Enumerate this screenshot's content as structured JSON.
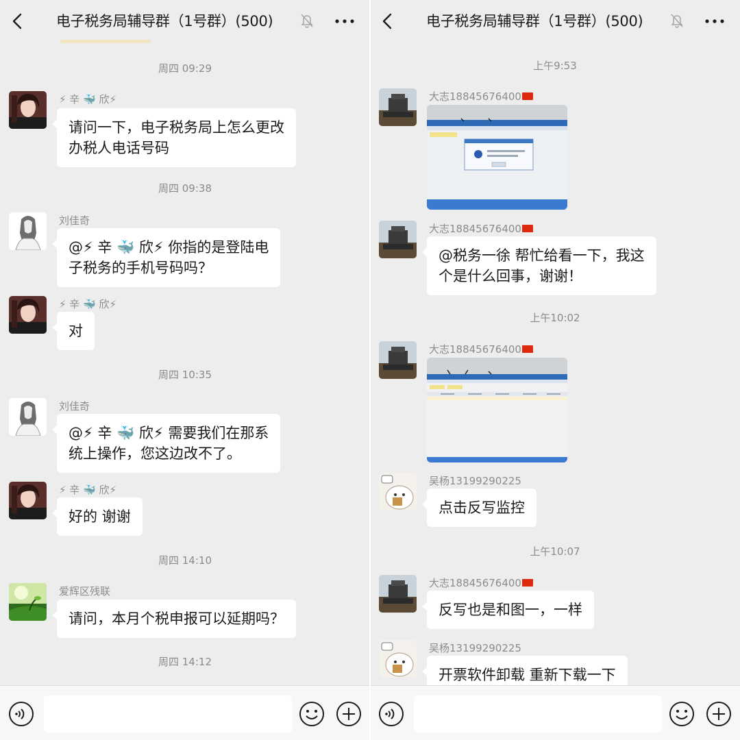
{
  "left": {
    "header": {
      "title": "电子税务局辅导群（1号群）(500)"
    },
    "messages": [
      {
        "time": "周四 09:29"
      },
      {
        "sender": "⚡ 辛 🐳 欣⚡",
        "lines": [
          "请问一下，电子税务局上怎么更改",
          "办税人电话号码"
        ]
      },
      {
        "time": "周四 09:38"
      },
      {
        "sender": "刘佳奇",
        "lines": [
          "@⚡ 辛 🐳 欣⚡ 你指的是登陆电",
          "子税务的手机号码吗？"
        ]
      },
      {
        "sender": "⚡ 辛 🐳 欣⚡",
        "lines": [
          "对"
        ]
      },
      {
        "time": "周四 10:35"
      },
      {
        "sender": "刘佳奇",
        "lines": [
          "@⚡ 辛 🐳 欣⚡ 需要我们在那系",
          "统上操作，您这边改不了。"
        ]
      },
      {
        "sender": "⚡ 辛 🐳 欣⚡",
        "lines": [
          "好的  谢谢"
        ]
      },
      {
        "time": "周四 14:10"
      },
      {
        "sender": "爱辉区残联",
        "lines": [
          "请问，本月个税申报可以延期吗？"
        ]
      },
      {
        "time": "周四 14:12"
      }
    ],
    "input": {
      "placeholder": ""
    }
  },
  "right": {
    "header": {
      "title": "电子税务局辅导群（1号群）(500)"
    },
    "messages": [
      {
        "time": "上午9:53"
      },
      {
        "sender": "大志18845676400",
        "image": "screenshot-dialog"
      },
      {
        "sender": "大志18845676400",
        "lines": [
          "@税务一徐  帮忙给看一下，我这",
          "个是什么回事，谢谢！"
        ]
      },
      {
        "time": "上午10:02"
      },
      {
        "sender": "大志18845676400",
        "image": "screenshot-table"
      },
      {
        "sender": "吴杨13199290225",
        "lines": [
          "点击反写监控"
        ]
      },
      {
        "time": "上午10:07"
      },
      {
        "sender": "大志18845676400",
        "lines": [
          "反写也是和图一，一样"
        ]
      },
      {
        "sender": "吴杨13199290225",
        "lines": [
          "开票软件卸载 重新下载一下"
        ]
      }
    ],
    "input": {
      "placeholder": ""
    }
  },
  "icons": {
    "back": "chevron-left-icon",
    "mute": "bell-off-icon",
    "more": "more-dots-icon",
    "voice": "voice-icon",
    "emoji": "emoji-icon",
    "plus": "plus-icon",
    "flag": "china-flag-icon"
  },
  "colors": {
    "background": "#ededed",
    "bubble": "#ffffff",
    "meta": "#8a8a8a"
  }
}
